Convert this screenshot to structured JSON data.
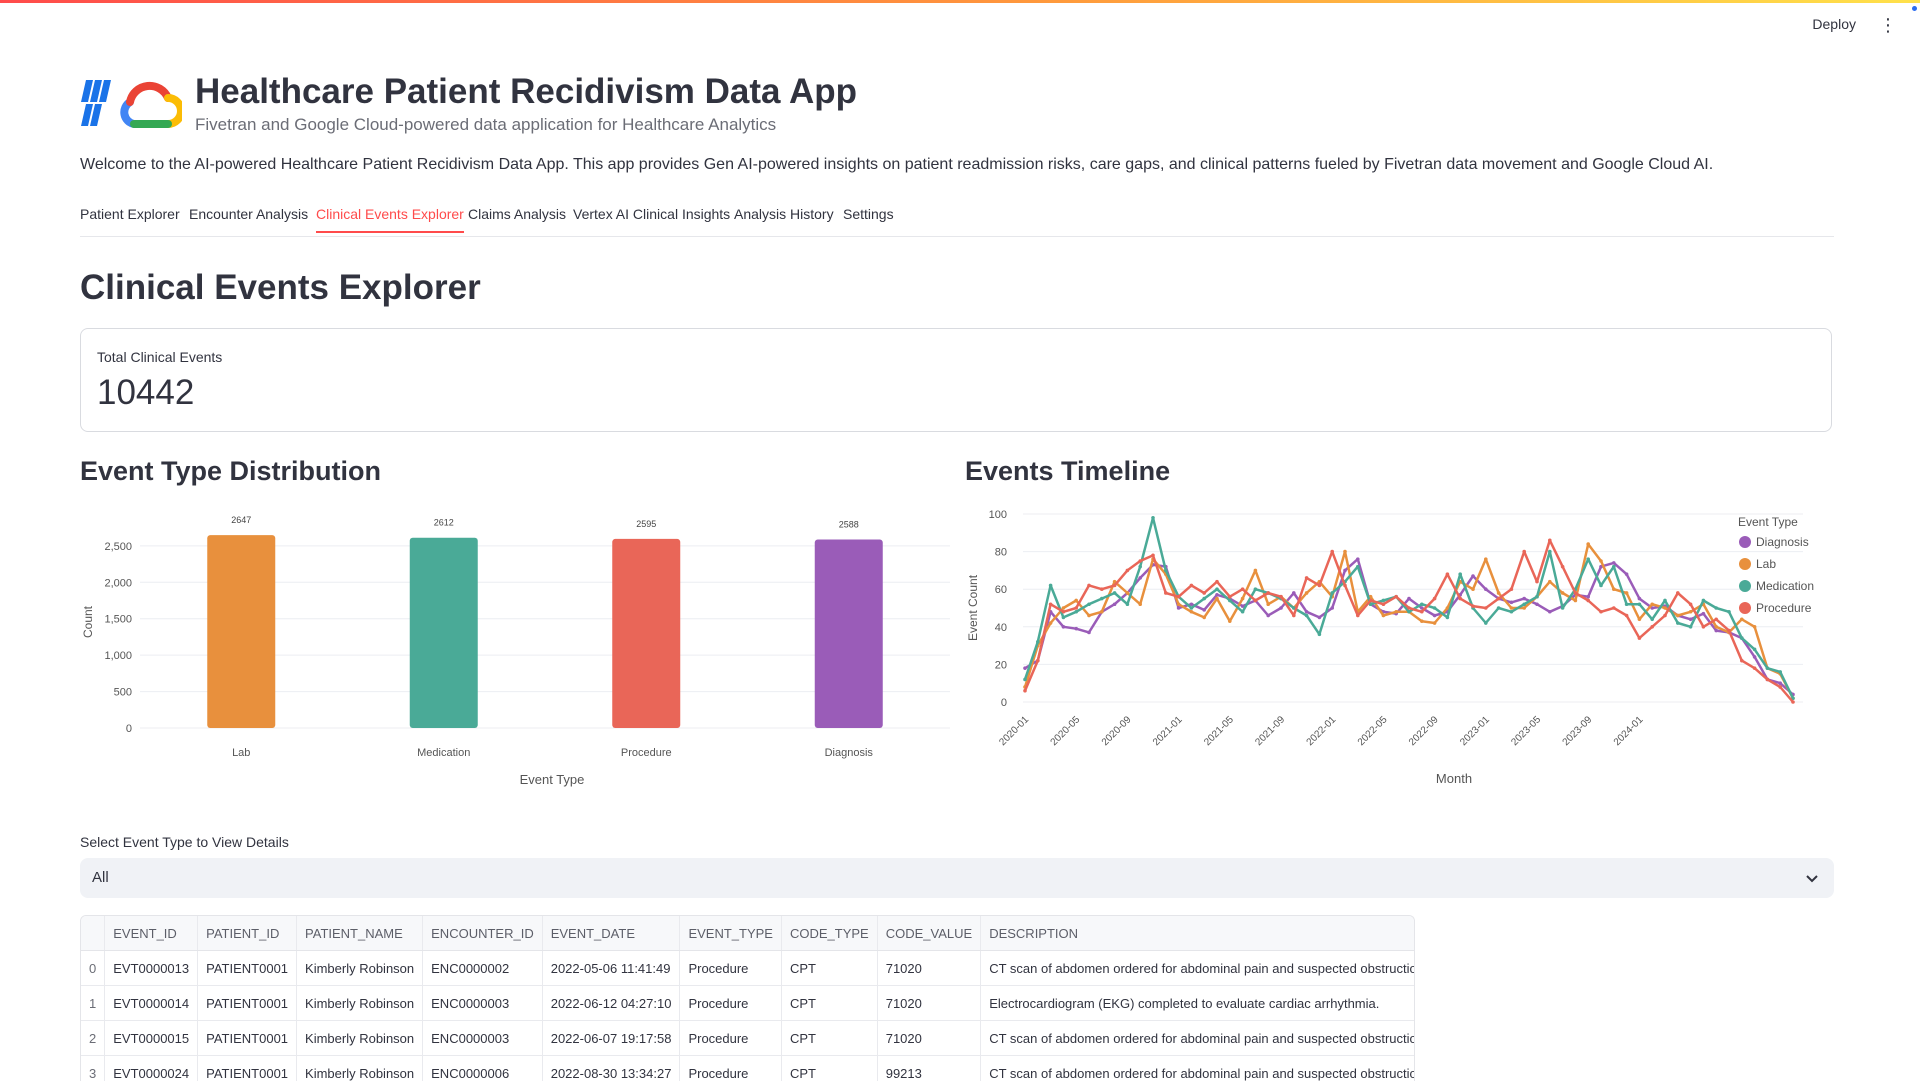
{
  "toolbar": {
    "deploy_label": "Deploy",
    "menu_icon": "kebab-menu-icon"
  },
  "header": {
    "title": "Healthcare Patient Recidivism Data App",
    "subtitle": "Fivetran and Google Cloud-powered data application for Healthcare Analytics",
    "logos": [
      "fivetran-logo",
      "google-cloud-logo"
    ]
  },
  "welcome": "Welcome to the AI-powered Healthcare Patient Recidivism Data App. This app provides Gen AI-powered insights on patient readmission risks, care gaps, and clinical patterns fueled by Fivetran data movement and Google Cloud AI.",
  "tabs": [
    {
      "label": "Patient Explorer"
    },
    {
      "label": "Encounter Analysis"
    },
    {
      "label": "Clinical Events Explorer",
      "active": true
    },
    {
      "label": "Claims Analysis"
    },
    {
      "label": "Vertex AI Clinical Insights"
    },
    {
      "label": "Analysis History"
    },
    {
      "label": "Settings"
    }
  ],
  "page": {
    "title": "Clinical Events Explorer"
  },
  "metric": {
    "label": "Total Clinical Events",
    "value": "10442"
  },
  "sections": {
    "distribution_title": "Event Type Distribution",
    "timeline_title": "Events Timeline"
  },
  "colors": {
    "accent": "#ff4b4b",
    "Lab": "#e8903d",
    "Medication": "#4aaa97",
    "Procedure": "#e96658",
    "Diagnosis": "#9a5cb8"
  },
  "chart_data": [
    {
      "type": "bar",
      "categories": [
        "Lab",
        "Medication",
        "Procedure",
        "Diagnosis"
      ],
      "values": [
        2647,
        2612,
        2595,
        2588
      ],
      "data_labels": [
        "2647",
        "2612",
        "2595",
        "2588"
      ],
      "colors": [
        "#e8903d",
        "#4aaa97",
        "#e96658",
        "#9a5cb8"
      ],
      "xlabel": "Event Type",
      "ylabel": "Count",
      "ylim": [
        0,
        2800
      ],
      "yticks": [
        0,
        500,
        1000,
        1500,
        2000,
        2500
      ],
      "ytick_labels": [
        "0",
        "500",
        "1,000",
        "1,500",
        "2,000",
        "2,500"
      ],
      "grid": true
    },
    {
      "type": "line",
      "xlabel": "Month",
      "ylabel": "Event Count",
      "ylim": [
        0,
        100
      ],
      "yticks": [
        0,
        20,
        40,
        60,
        80,
        100
      ],
      "x_start": "2020-01",
      "xtick_labels": [
        "2020-01",
        "2020-05",
        "2020-09",
        "2021-01",
        "2021-05",
        "2021-09",
        "2022-01",
        "2022-05",
        "2022-09",
        "2023-01",
        "2023-05",
        "2023-09",
        "2024-01"
      ],
      "legend_title": "Event Type",
      "legend_position": "right",
      "grid": true,
      "series": [
        {
          "name": "Diagnosis",
          "color": "#9a5cb8",
          "values": [
            18,
            22,
            48,
            40,
            39,
            37,
            48,
            52,
            58,
            66,
            73,
            72,
            50,
            52,
            49,
            57,
            55,
            51,
            54,
            46,
            50,
            58,
            48,
            45,
            50,
            70,
            76,
            52,
            48,
            47,
            55,
            50,
            46,
            48,
            57,
            67,
            60,
            55,
            53,
            55,
            52,
            48,
            51,
            57,
            56,
            72,
            74,
            68,
            55,
            50,
            51,
            46,
            44,
            47,
            38,
            37,
            34,
            24,
            12,
            10,
            4
          ]
        },
        {
          "name": "Lab",
          "color": "#e8903d",
          "values": [
            8,
            30,
            42,
            50,
            54,
            46,
            48,
            64,
            58,
            52,
            76,
            68,
            52,
            48,
            45,
            55,
            43,
            55,
            70,
            52,
            56,
            50,
            58,
            64,
            56,
            80,
            48,
            56,
            46,
            48,
            48,
            43,
            42,
            50,
            64,
            60,
            76,
            58,
            50,
            50,
            56,
            64,
            58,
            54,
            84,
            75,
            60,
            58,
            44,
            52,
            50,
            46,
            48,
            52,
            40,
            37,
            44,
            40,
            18,
            15,
            2
          ]
        },
        {
          "name": "Medication",
          "color": "#4aaa97",
          "values": [
            12,
            32,
            62,
            45,
            48,
            52,
            55,
            58,
            52,
            72,
            98,
            70,
            56,
            50,
            55,
            60,
            54,
            48,
            60,
            58,
            55,
            50,
            46,
            36,
            58,
            64,
            72,
            52,
            54,
            56,
            48,
            52,
            50,
            45,
            68,
            50,
            42,
            50,
            48,
            52,
            56,
            80,
            50,
            60,
            76,
            62,
            72,
            52,
            52,
            44,
            54,
            42,
            40,
            54,
            50,
            48,
            34,
            28,
            18,
            16,
            2
          ]
        },
        {
          "name": "Procedure",
          "color": "#e96658",
          "values": [
            6,
            22,
            52,
            48,
            50,
            62,
            60,
            62,
            70,
            75,
            78,
            58,
            56,
            62,
            58,
            64,
            56,
            60,
            54,
            58,
            56,
            46,
            66,
            62,
            80,
            62,
            46,
            54,
            52,
            56,
            50,
            48,
            55,
            68,
            55,
            51,
            50,
            55,
            60,
            80,
            64,
            86,
            72,
            58,
            54,
            48,
            50,
            46,
            34,
            40,
            46,
            58,
            52,
            40,
            44,
            38,
            22,
            18,
            12,
            8,
            0
          ]
        }
      ]
    }
  ],
  "select": {
    "label": "Select Event Type to View Details",
    "value": "All"
  },
  "table": {
    "columns": [
      "",
      "EVENT_ID",
      "PATIENT_ID",
      "PATIENT_NAME",
      "ENCOUNTER_ID",
      "EVENT_DATE",
      "EVENT_TYPE",
      "CODE_TYPE",
      "CODE_VALUE",
      "DESCRIPTION"
    ],
    "rows": [
      [
        "0",
        "EVT0000013",
        "PATIENT0001",
        "Kimberly Robinson",
        "ENC0000002",
        "2022-05-06 11:41:49",
        "Procedure",
        "CPT",
        "71020",
        "CT scan of abdomen ordered for abdominal pain and suspected obstruction."
      ],
      [
        "1",
        "EVT0000014",
        "PATIENT0001",
        "Kimberly Robinson",
        "ENC0000003",
        "2022-06-12 04:27:10",
        "Procedure",
        "CPT",
        "71020",
        "Electrocardiogram (EKG) completed to evaluate cardiac arrhythmia."
      ],
      [
        "2",
        "EVT0000015",
        "PATIENT0001",
        "Kimberly Robinson",
        "ENC0000003",
        "2022-06-07 19:17:58",
        "Procedure",
        "CPT",
        "71020",
        "CT scan of abdomen ordered for abdominal pain and suspected obstruction."
      ],
      [
        "3",
        "EVT0000024",
        "PATIENT0001",
        "Kimberly Robinson",
        "ENC0000006",
        "2022-08-30 13:34:27",
        "Procedure",
        "CPT",
        "99213",
        "CT scan of abdomen ordered for abdominal pain and suspected obstruction."
      ]
    ]
  }
}
